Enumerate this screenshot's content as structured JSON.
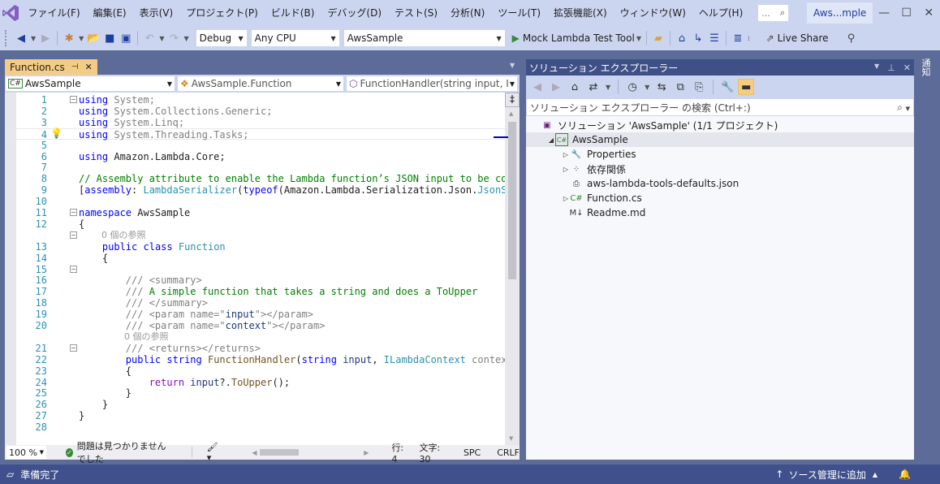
{
  "menu": {
    "items": [
      "ファイル(F)",
      "編集(E)",
      "表示(V)",
      "プロジェクト(P)",
      "ビルド(B)",
      "デバッグ(D)",
      "テスト(S)",
      "分析(N)",
      "ツール(T)",
      "拡張機能(X)",
      "ウィンドウ(W)",
      "ヘルプ(H)"
    ],
    "search_placeholder": "...",
    "window_title": "Aws...mple"
  },
  "toolbar": {
    "configuration": "Debug",
    "platform": "Any CPU",
    "startup_project": "AwsSample",
    "run_label": "Mock Lambda Test Tool",
    "live_share": "Live Share"
  },
  "editor": {
    "tab_label": "Function.cs",
    "nav_project": "AwsSample",
    "nav_type": "AwsSample.Function",
    "nav_member": "FunctionHandler(string input, ILa",
    "zoom": "100 %",
    "issues": "問題は見つかりませんでした",
    "line": "行: 4",
    "col": "文字: 30",
    "whitespace": "SPC",
    "line_ending": "CRLF",
    "codelens_refs": "0 個の参照",
    "lines": [
      {
        "n": "1",
        "html": "<span class='kw'>using</span><span class='gr'> System;</span>"
      },
      {
        "n": "2",
        "html": "<span class='kw'>using</span><span class='gr'> System.Collections.Generic;</span>"
      },
      {
        "n": "3",
        "html": "<span class='kw'>using</span><span class='gr'> System.Linq;</span>"
      },
      {
        "n": "4",
        "html": "<span class='kw'>using</span><span class='gr'> System.Threading.Tasks;</span>"
      },
      {
        "n": "5",
        "html": ""
      },
      {
        "n": "6",
        "html": "<span class='kw'>using</span> Amazon.Lambda.Core;"
      },
      {
        "n": "7",
        "html": ""
      },
      {
        "n": "8",
        "html": "<span class='cm'>// Assembly attribute to enable the Lambda function’s JSON input to be conv</span>"
      },
      {
        "n": "9",
        "html": "[<span class='kw'>assembly</span>: <span class='ty'>LambdaSerializer</span>(<span class='kw'>typeof</span>(Amazon.Lambda.Serialization.Json.<span class='ty'>JsonSer</span>"
      },
      {
        "n": "10",
        "html": ""
      },
      {
        "n": "11",
        "html": "<span class='kw'>namespace</span> AwsSample"
      },
      {
        "n": "12",
        "html": "{"
      },
      {
        "n": "13",
        "html": "    <span class='kw'>public</span> <span class='kw'>class</span> <span class='ty'>Function</span>"
      },
      {
        "n": "14",
        "html": "    {"
      },
      {
        "n": "15",
        "html": ""
      },
      {
        "n": "16",
        "html": "        <span class='dc'>/// &lt;summary&gt;</span>"
      },
      {
        "n": "17",
        "html": "        <span class='dc'>///</span> <span class='cm'>A simple function that takes a string and does a ToUpper</span>"
      },
      {
        "n": "18",
        "html": "        <span class='dc'>/// &lt;/summary&gt;</span>"
      },
      {
        "n": "19",
        "html": "        <span class='dc'>/// &lt;param name=\"</span><span class='nm'>input</span><span class='dc'>\"&gt;&lt;/param&gt;</span>"
      },
      {
        "n": "20",
        "html": "        <span class='dc'>/// &lt;param name=\"</span><span class='nm'>context</span><span class='dc'>\"&gt;&lt;/param&gt;</span>"
      },
      {
        "n": "21",
        "html": "        <span class='dc'>/// &lt;returns&gt;&lt;/returns&gt;</span>"
      },
      {
        "n": "22",
        "html": "        <span class='kw'>public</span> <span class='kw'>string</span> <span class='mt'>FunctionHandler</span>(<span class='kw'>string</span> <span class='nm'>input</span>, <span class='ty'>ILambdaContext</span> <span class='gr'>context</span>)"
      },
      {
        "n": "23",
        "html": "        {"
      },
      {
        "n": "24",
        "html": "            <span class='ctl'>return</span> <span class='nm'>input</span>?.<span class='mt'>ToUpper</span>();"
      },
      {
        "n": "25",
        "html": "        }"
      },
      {
        "n": "26",
        "html": "    }"
      },
      {
        "n": "27",
        "html": "}"
      },
      {
        "n": "28",
        "html": ""
      }
    ]
  },
  "solution_explorer": {
    "title": "ソリューション エクスプローラー",
    "search_placeholder": "ソリューション エクスプローラー の検索 (Ctrl+:)",
    "tree": [
      {
        "label": "ソリューション 'AwsSample' (1/1 プロジェクト)",
        "icon": "solution-icon",
        "depth": 0,
        "expander": ""
      },
      {
        "label": "AwsSample",
        "icon": "csharp-project-icon",
        "depth": 1,
        "expander": "◢",
        "selected": true
      },
      {
        "label": "Properties",
        "icon": "wrench-icon",
        "depth": 2,
        "expander": "▷"
      },
      {
        "label": "依存関係",
        "icon": "dependencies-icon",
        "depth": 2,
        "expander": "▷"
      },
      {
        "label": "aws-lambda-tools-defaults.json",
        "icon": "json-file-icon",
        "depth": 2,
        "expander": ""
      },
      {
        "label": "Function.cs",
        "icon": "csharp-file-icon",
        "depth": 2,
        "expander": "▷"
      },
      {
        "label": "Readme.md",
        "icon": "markdown-file-icon",
        "depth": 2,
        "expander": ""
      }
    ]
  },
  "side_strip": {
    "label": "通知"
  },
  "statusbar": {
    "ready": "準備完了",
    "source_control": "ソース管理に追加"
  },
  "colors": {
    "accent": "#68217a",
    "chrome": "#ccd5f0",
    "statusbar": "#40508d",
    "tab_active": "#f5cc84"
  }
}
